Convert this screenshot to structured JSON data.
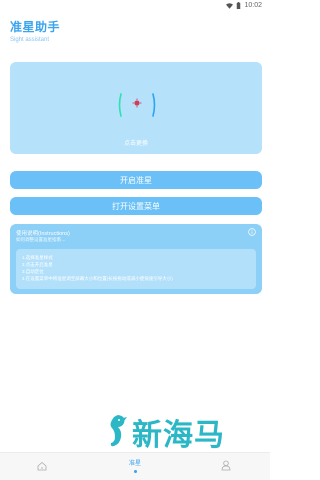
{
  "status_bar": {
    "time": "10:02"
  },
  "header": {
    "title": "准星助手",
    "subtitle": "Sight assistant"
  },
  "preview": {
    "label": "点击更换"
  },
  "buttons": {
    "start": "开启准星",
    "settings_menu": "打开设置菜单"
  },
  "instructions": {
    "title": "使用说明(Instructions)",
    "subtitle": "如何调整设置准星指南→",
    "steps": [
      "1.选择准星样式",
      "2.点击开启准星",
      "3.自动定位",
      "4.在设置菜单中将准星调至屏幕大小和位置(长按拖动或减小使快速引导大小)"
    ]
  },
  "watermark": {
    "text": "新海马"
  },
  "nav": {
    "center_label": "准星"
  },
  "colors": {
    "accent": "#3aa4ee",
    "button": "#6bc1f7",
    "card": "#b5e1fb",
    "watermark": "#2bb7c6"
  },
  "icons": {
    "wifi": "wifi-icon",
    "battery": "battery-icon",
    "info": "info-icon",
    "home": "home-icon",
    "user": "user-icon",
    "crosshair": "crosshair-icon"
  }
}
